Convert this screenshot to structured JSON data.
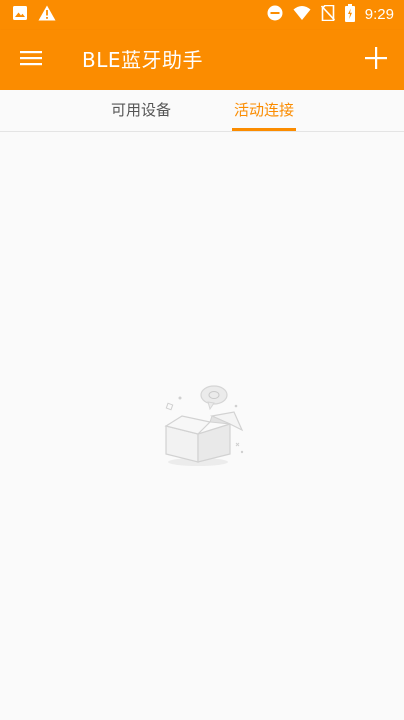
{
  "status_bar": {
    "time": "9:29",
    "icons": [
      "image-icon",
      "warning-icon",
      "do-not-disturb-icon",
      "wifi-icon",
      "no-sim-icon",
      "battery-icon"
    ]
  },
  "app_bar": {
    "title": "BLE蓝牙助手",
    "menu_icon": "hamburger-menu-icon",
    "add_icon": "plus-icon",
    "color": "#fb8c00"
  },
  "tabs": [
    {
      "label": "可用设备",
      "selected": false
    },
    {
      "label": "活动连接",
      "selected": true
    }
  ],
  "colors": {
    "accent": "#fb8c00",
    "background": "#fafafa",
    "tab_text": "#555555"
  },
  "empty_state": {
    "icon": "empty-box-icon"
  }
}
